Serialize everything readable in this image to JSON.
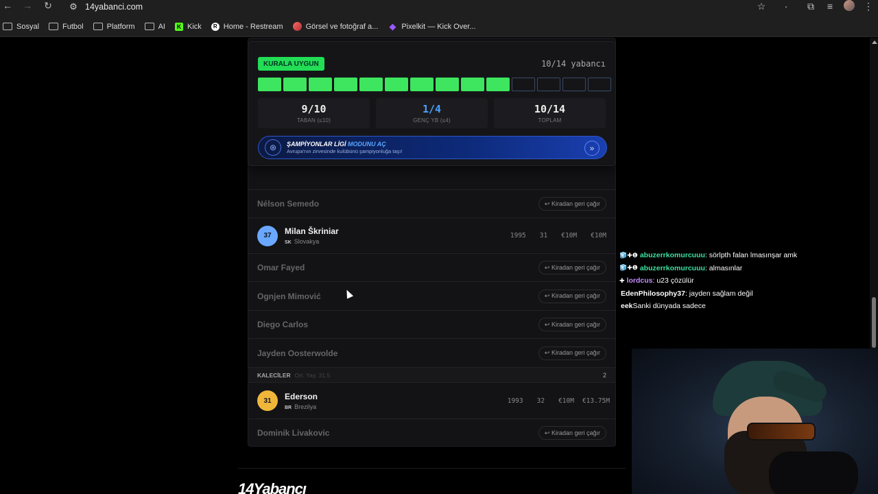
{
  "browser": {
    "url": "14yabanci.com",
    "bookmarks": [
      {
        "label": "Sosyal",
        "icon": "folder-icon"
      },
      {
        "label": "Futbol",
        "icon": "folder-icon"
      },
      {
        "label": "Platform",
        "icon": "folder-icon"
      },
      {
        "label": "AI",
        "icon": "folder-icon"
      },
      {
        "label": "Kick",
        "icon": "kick-icon"
      },
      {
        "label": "Home - Restream",
        "icon": "restream-icon"
      },
      {
        "label": "Görsel ve fotoğraf a...",
        "icon": "image-tool-icon"
      },
      {
        "label": "Pixelkit — Kick Over...",
        "icon": "pixelkit-icon"
      }
    ]
  },
  "panel": {
    "badge": "KURALA UYGUN",
    "quota": "10/14 yabancı",
    "slots_filled": 10,
    "slots_total": 14,
    "stats": [
      {
        "value": "9/10",
        "label": "TABAN (≤10)",
        "accent": false
      },
      {
        "value": "1/4",
        "label": "GENÇ YB (≤4)",
        "accent": true
      },
      {
        "value": "10/14",
        "label": "TOPLAM",
        "accent": false
      }
    ],
    "cl_banner": {
      "title_prefix": "ŞAMPİYONLAR LİGİ",
      "title_highlight": "MODUNU AÇ",
      "subtitle": "Avrupa'nın zirvesinde kulübünü şampiyonluğa taşı!"
    }
  },
  "recall_label": "↩ Kiradan geri çağır",
  "loaned": {
    "semedo": "Nélson Semedo",
    "fayed": "Omar Fayed",
    "mimovic": "Ognjen Mimović",
    "carlos": "Diego Carlos",
    "oosterwolde": "Jayden Oosterwolde",
    "livakovic": "Dominik Livakovic"
  },
  "players": {
    "skriniar": {
      "number": "37",
      "name": "Milan Škriniar",
      "code": "SK",
      "country": "Slovakya",
      "year": "1995",
      "age": "31",
      "v1": "€10M",
      "v2": "€10M",
      "color": "#6aa8ff"
    },
    "ederson": {
      "number": "31",
      "name": "Ederson",
      "code": "BR",
      "country": "Brezilya",
      "year": "1993",
      "age": "32",
      "v1": "€10M",
      "v2": "€13.75M",
      "color": "#f0b63a"
    }
  },
  "section": {
    "title": "KALECİLER",
    "sub": "Ort. Yaş: 31.5",
    "count": "2"
  },
  "footer_logo": "14Yabancı",
  "chat": [
    {
      "badges": "🧊✚❶",
      "user": "abuzerrkomurcuuu",
      "color": "#3ee0a0",
      "text": " : sörlpth falan lmasınşar amk"
    },
    {
      "badges": "🧊✚❶",
      "user": "abuzerrkomurcuuu",
      "color": "#3ee0a0",
      "text": " : almasınlar"
    },
    {
      "badges": "✚",
      "user": "lordcus",
      "color": "#c58cff",
      "text": " : u23 çözülür"
    },
    {
      "badges": "",
      "user": "EdenPhilosophy37",
      "color": "#ffffff",
      "text": " : jayden sağlam değil"
    },
    {
      "badges": "",
      "user": "eek",
      "color": "#ffffff",
      "text": " Sanki dünyada sadece"
    }
  ]
}
